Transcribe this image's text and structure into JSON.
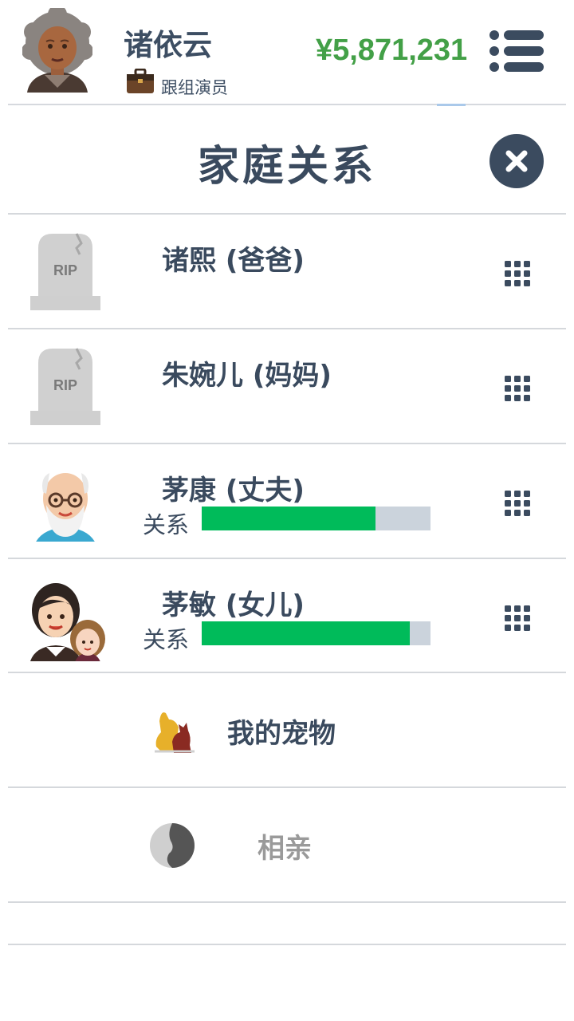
{
  "header": {
    "name": "诸依云",
    "job": "跟组演员",
    "money": "¥5,871,231",
    "avatar_icon": "old-woman-avatar-icon",
    "job_icon": "briefcase-icon",
    "menu_icon": "list-menu-icon"
  },
  "page": {
    "title": "家庭关系",
    "close_icon": "close-icon"
  },
  "relatives": [
    {
      "name": "诸熙 (爸爸)",
      "icon": "tombstone-icon",
      "deceased": true,
      "rip_text": "RIP"
    },
    {
      "name": "朱婉儿 (妈妈)",
      "icon": "tombstone-icon",
      "deceased": true,
      "rip_text": "RIP"
    },
    {
      "name": "茅康 (丈夫)",
      "icon": "old-man-avatar-icon",
      "deceased": false,
      "relation_label": "关系",
      "relation_level": 0.76
    },
    {
      "name": "茅敏 (女儿)",
      "icon": "mother-daughter-avatar-icon",
      "deceased": false,
      "relation_label": "关系",
      "relation_level": 0.91
    }
  ],
  "actions": {
    "pets": {
      "label": "我的宠物",
      "icon": "pets-icon"
    },
    "dating": {
      "label": "相亲",
      "icon": "dating-icon"
    }
  },
  "colors": {
    "text": "#3a4a5e",
    "money": "#43a047",
    "relation_fill": "#00bb5a",
    "relation_track": "#cbd3dc",
    "tombstone": "#d0d0d0"
  }
}
